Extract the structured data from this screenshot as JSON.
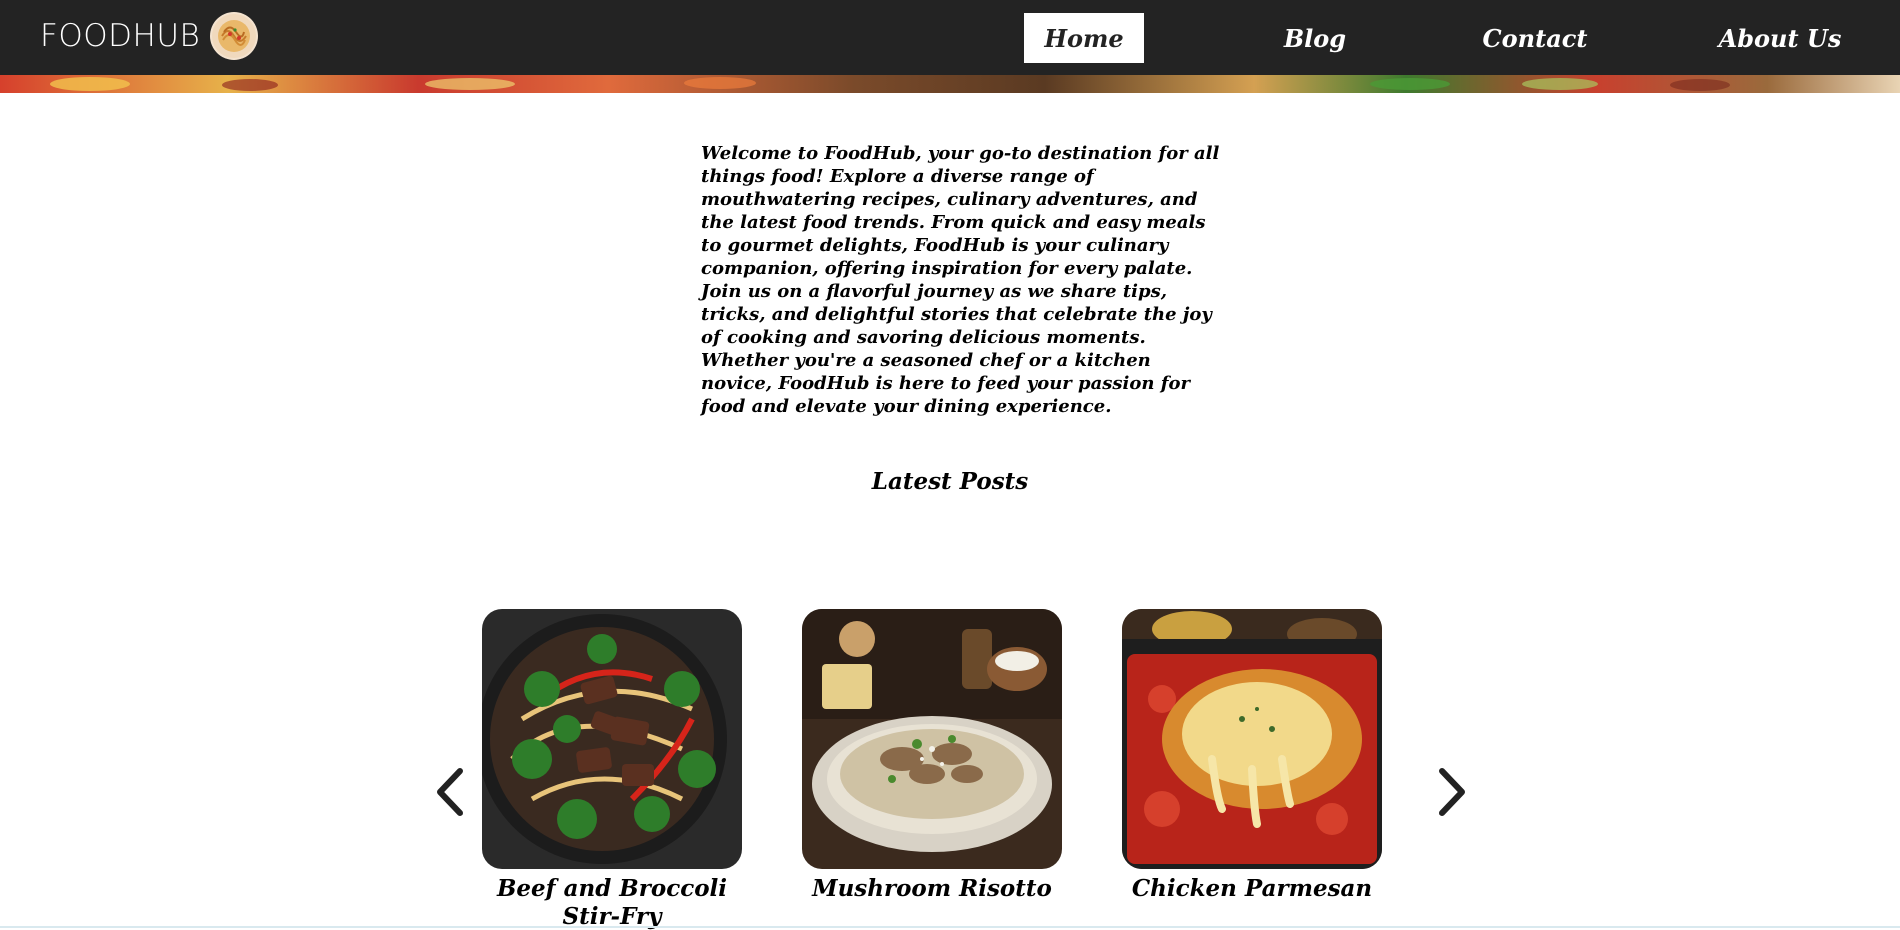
{
  "brand": {
    "name": "FOODHUB",
    "logo_icon": "pasta-plate-icon"
  },
  "nav": {
    "items": [
      {
        "label": "Home",
        "active": true
      },
      {
        "label": "Blog",
        "active": false
      },
      {
        "label": "Contact",
        "active": false
      },
      {
        "label": "About Us",
        "active": false
      }
    ]
  },
  "intro": {
    "text": "Welcome to FoodHub, your go-to destination for all things food! Explore a diverse range of mouthwatering recipes, culinary adventures, and the latest food trends. From quick and easy meals to gourmet delights, FoodHub is your culinary companion, offering inspiration for every palate. Join us on a flavorful journey as we share tips, tricks, and delightful stories that celebrate the joy of cooking and savoring delicious moments. Whether you're a seasoned chef or a kitchen novice, FoodHub is here to feed your passion for food and elevate your dining experience."
  },
  "latest_posts": {
    "title": "Latest Posts",
    "posts": [
      {
        "title": "Beef and Broccoli Stir-Fry"
      },
      {
        "title": "Mushroom Risotto"
      },
      {
        "title": "Chicken Parmesan"
      }
    ],
    "prev_icon": "chevron-left-icon",
    "next_icon": "chevron-right-icon"
  },
  "colors": {
    "header_bg": "#232323",
    "text": "#000000",
    "nav_text": "#ffffff",
    "active_bg": "#ffffff"
  }
}
